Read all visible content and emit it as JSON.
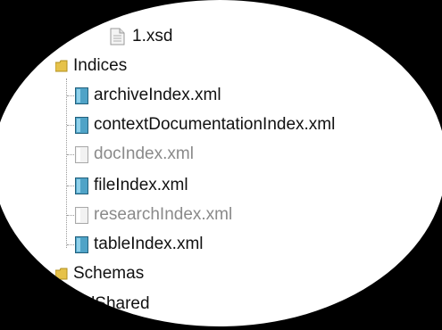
{
  "tree": {
    "items": [
      {
        "label": "1.xsd",
        "type": "doc",
        "dim": false
      },
      {
        "label": "Indices",
        "type": "folder",
        "dim": false
      },
      {
        "label": "archiveIndex.xml",
        "type": "xml",
        "dim": false
      },
      {
        "label": "contextDocumentationIndex.xml",
        "type": "xml",
        "dim": false
      },
      {
        "label": "docIndex.xml",
        "type": "xml",
        "dim": true
      },
      {
        "label": "fileIndex.xml",
        "type": "xml",
        "dim": false
      },
      {
        "label": "researchIndex.xml",
        "type": "xml",
        "dim": true
      },
      {
        "label": "tableIndex.xml",
        "type": "xml",
        "dim": false
      },
      {
        "label": "Schemas",
        "type": "folder",
        "dim": false
      },
      {
        "label": "calShared",
        "type": "folder",
        "dim": false
      }
    ]
  },
  "colors": {
    "background": "#000000",
    "lens": "#ffffff",
    "xml_icon": "#4fa3c7",
    "folder_icon": "#e6c24a",
    "dim_text": "#8a8a8a"
  }
}
